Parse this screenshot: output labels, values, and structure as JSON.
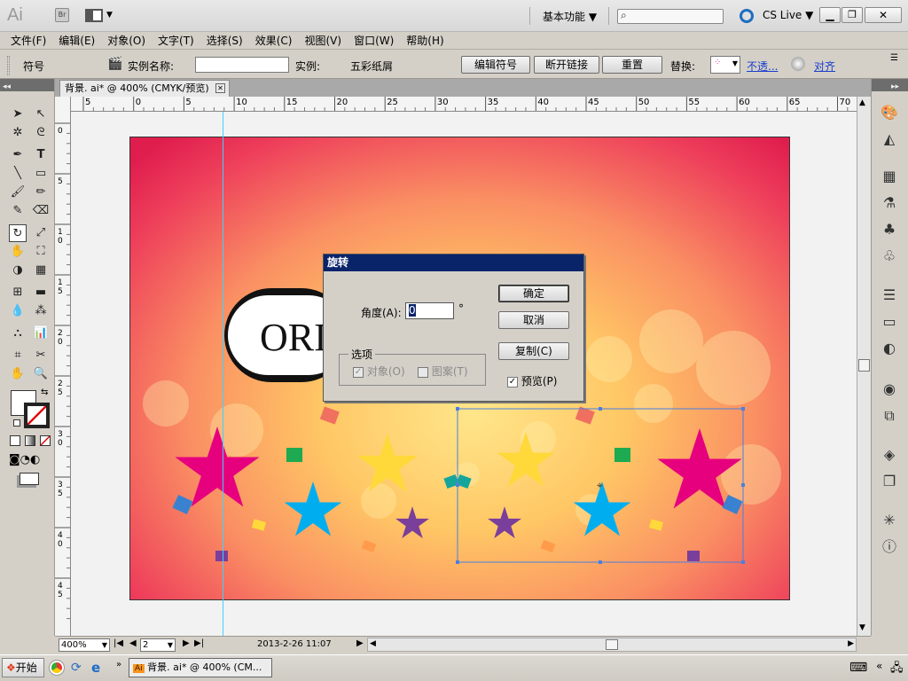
{
  "app": {
    "logo": "Ai",
    "bridge": "Br",
    "workspace": "基本功能 ▼",
    "cslive": "CS Live ▼",
    "search_placeholder": ""
  },
  "menu": [
    "文件(F)",
    "编辑(E)",
    "对象(O)",
    "文字(T)",
    "选择(S)",
    "效果(C)",
    "视图(V)",
    "窗口(W)",
    "帮助(H)"
  ],
  "control": {
    "symbol_label": "符号",
    "instance_name_label": "实例名称:",
    "instance_label": "实例:",
    "instance_value": "五彩纸屑",
    "edit_symbol": "编辑符号",
    "break_link": "断开链接",
    "reset": "重置",
    "replace_label": "替换:",
    "opacity_link": "不透...",
    "align_link": "对齐"
  },
  "document": {
    "tab_title": "背景. ai* @ 400% (CMYK/预览)"
  },
  "hruler_labels": [
    "5",
    "0",
    "5",
    "10",
    "15",
    "20",
    "25",
    "30",
    "35",
    "40",
    "45",
    "50",
    "55",
    "60",
    "65",
    "70"
  ],
  "vruler_labels": [
    "0",
    "5",
    "1 0",
    "1 5",
    "2 0",
    "2 5",
    "3 0",
    "3 5",
    "4 0",
    "4 5"
  ],
  "art": {
    "text": "ORI"
  },
  "dialog": {
    "title": "旋转",
    "angle_label": "角度(A):",
    "angle_value": "0",
    "degree": "°",
    "ok": "确定",
    "cancel": "取消",
    "copy": "复制(C)",
    "preview": "预览(P)",
    "options_label": "选项",
    "objects": "对象(O)",
    "patterns": "图案(T)"
  },
  "status": {
    "zoom": "400%",
    "page": "2",
    "info": "2013-2-26  11:07"
  },
  "taskbar": {
    "start": "开始",
    "task": "背景. ai* @ 400% (CM..."
  },
  "colors": {
    "bg_top": "#f0606a",
    "bg_glow": "#ffd35a",
    "selection": "#4a7fe0",
    "guide": "#40d0ff",
    "dialog_title": "#0a246a"
  }
}
